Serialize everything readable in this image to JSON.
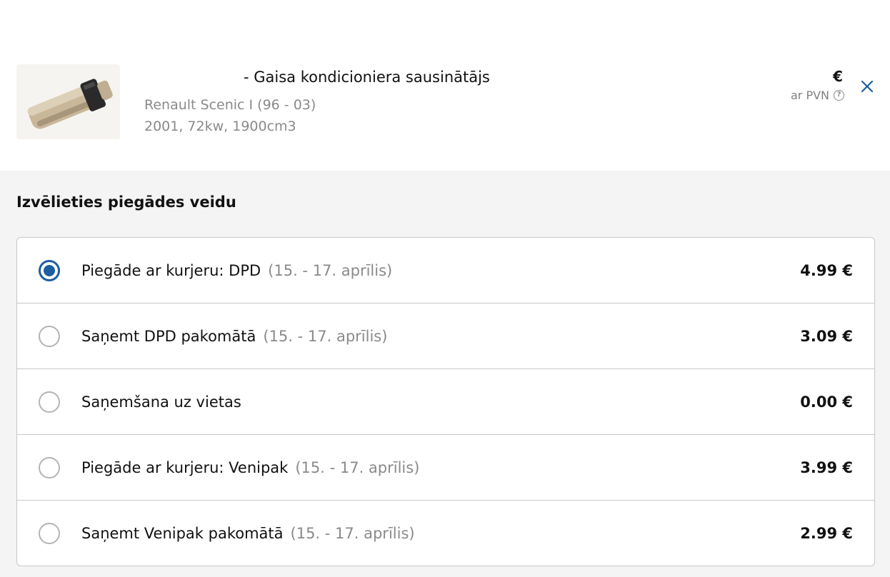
{
  "product": {
    "title": "- Gaisa kondicioniera sausinātājs",
    "vehicle": "Renault Scenic I (96 - 03)",
    "specs": "2001, 72kw, 1900cm3",
    "price_currency": "€",
    "vat_label": "ar PVN",
    "help_icon": "question-circle-icon",
    "close_icon": "close-icon"
  },
  "delivery": {
    "title": "Izvēlieties piegādes veidu",
    "options": [
      {
        "label": "Piegāde ar kurjeru: DPD",
        "dates": "(15. - 17. aprīlis)",
        "price": "4.99 €",
        "selected": true
      },
      {
        "label": "Saņemt DPD pakomātā",
        "dates": "(15. - 17. aprīlis)",
        "price": "3.09 €",
        "selected": false
      },
      {
        "label": "Saņemšana uz vietas",
        "dates": "",
        "price": "0.00 €",
        "selected": false
      },
      {
        "label": "Piegāde ar kurjeru: Venipak",
        "dates": "(15. - 17. aprīlis)",
        "price": "3.99 €",
        "selected": false
      },
      {
        "label": "Saņemt Venipak pakomātā",
        "dates": "(15. - 17. aprīlis)",
        "price": "2.99 €",
        "selected": false
      }
    ]
  },
  "colors": {
    "accent": "#1d5ea0",
    "muted_text": "#8a8a8a",
    "panel_bg": "#f4f4f4"
  }
}
